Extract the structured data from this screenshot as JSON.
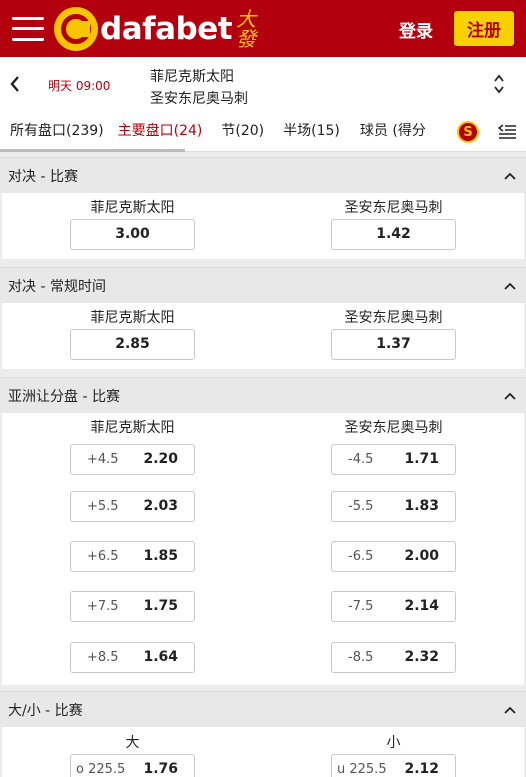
{
  "header": {
    "brand": "dafabet",
    "brand_cn": "大發",
    "login_label": "登录",
    "register_label": "注册",
    "colors": {
      "primary": "#b3000f",
      "accent": "#f7d200"
    }
  },
  "match": {
    "time": "明天 09:00",
    "home": "菲尼克斯太阳",
    "away": "圣安东尼奥马刺"
  },
  "tabs": [
    {
      "label": "所有盘口(239)"
    },
    {
      "label": "主要盘口(24)"
    },
    {
      "label": "节(20)"
    },
    {
      "label": "半场(15)"
    },
    {
      "label": "球员 (得分"
    }
  ],
  "tabs_s_icon": "S",
  "sections": [
    {
      "title": "对决 - 比赛",
      "left_label": "菲尼克斯太阳",
      "right_label": "圣安东尼奥马刺",
      "rows": [
        {
          "left": "3.00",
          "right": "1.42"
        }
      ]
    },
    {
      "title": "对决 - 常规时间",
      "left_label": "菲尼克斯太阳",
      "right_label": "圣安东尼奥马刺",
      "rows": [
        {
          "left": "2.85",
          "right": "1.37"
        }
      ]
    },
    {
      "title": "亚洲让分盘 - 比赛",
      "left_label": "菲尼克斯太阳",
      "right_label": "圣安东尼奥马刺",
      "rows": [
        {
          "left_line": "+4.5",
          "left": "2.20",
          "right_line": "-4.5",
          "right": "1.71"
        },
        {
          "left_line": "+5.5",
          "left": "2.03",
          "right_line": "-5.5",
          "right": "1.83"
        },
        {
          "left_line": "+6.5",
          "left": "1.85",
          "right_line": "-6.5",
          "right": "2.00"
        },
        {
          "left_line": "+7.5",
          "left": "1.75",
          "right_line": "-7.5",
          "right": "2.14"
        },
        {
          "left_line": "+8.5",
          "left": "1.64",
          "right_line": "-8.5",
          "right": "2.32"
        }
      ]
    },
    {
      "title": "大/小 - 比赛",
      "left_label": "大",
      "right_label": "小",
      "rows": [
        {
          "left_line": "o 225.5",
          "left": "1.76",
          "right_line": "u 225.5",
          "right": "2.12"
        }
      ]
    }
  ],
  "icons": [
    "hamburger-icon",
    "back-chevron-icon",
    "up-down-arrows-icon",
    "s-badge-icon",
    "collapse-menu-icon",
    "chevron-up-icon"
  ]
}
